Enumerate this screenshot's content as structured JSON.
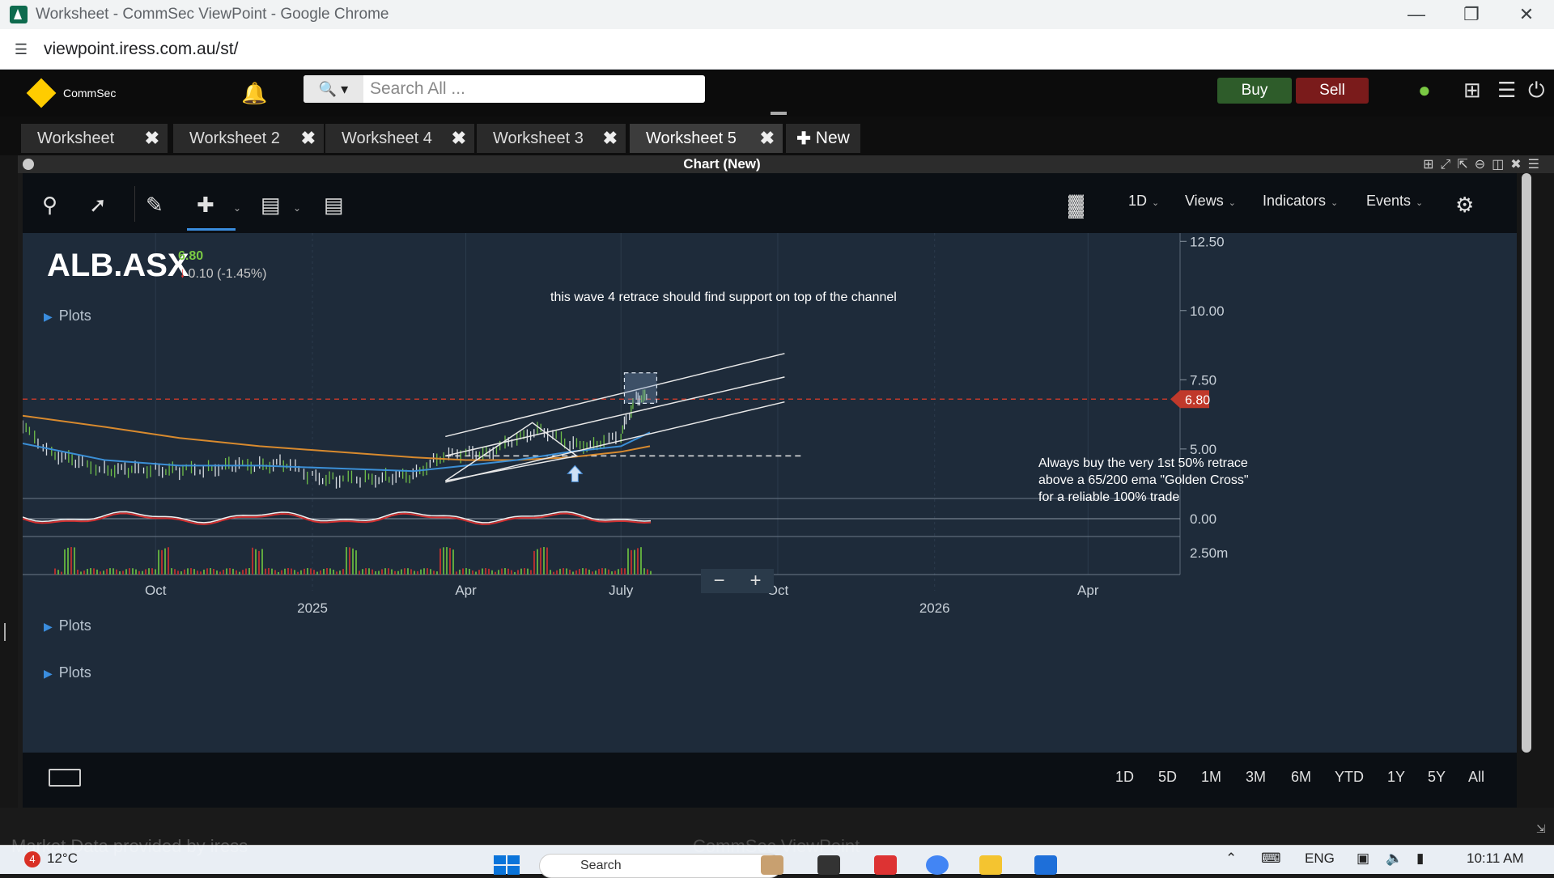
{
  "browser": {
    "window_title": "Worksheet - CommSec ViewPoint - Google Chrome",
    "url": "viewpoint.iress.com.au/st/"
  },
  "app": {
    "brand": "CommSec",
    "search_placeholder": "Search All ...",
    "buy_label": "Buy",
    "sell_label": "Sell"
  },
  "tabs": [
    {
      "label": "Worksheet",
      "active": false
    },
    {
      "label": "Worksheet 2",
      "active": false
    },
    {
      "label": "Worksheet 4",
      "active": false
    },
    {
      "label": "Worksheet 3",
      "active": false
    },
    {
      "label": "Worksheet 5",
      "active": true
    }
  ],
  "new_tab_label": "New",
  "panel": {
    "title": "Chart (New)"
  },
  "toolbar": {
    "interval": "1D",
    "views": "Views",
    "indicators": "Indicators",
    "events": "Events"
  },
  "quote": {
    "symbol": "ALB.ASX",
    "last": "6.80",
    "change": "0.10 (-1.45%)",
    "direction": "down"
  },
  "plots_label": "Plots",
  "annotations": {
    "wave_note": "this wave 4 retrace should find support on top of the channel",
    "golden_cross_note": [
      "Always buy the very 1st 50% retrace",
      "above a 65/200 ema \"Golden Cross\"",
      "for a reliable 100% trade"
    ]
  },
  "chart_data": {
    "type": "line",
    "symbol": "ALB.ASX",
    "y_ticks": [
      "12.50",
      "10.00",
      "7.50",
      "5.00"
    ],
    "ylim": [
      3.3,
      12.8
    ],
    "current_price_label": "6.80",
    "current_price": 6.8,
    "indicator_tick": "0.00",
    "volume_tick": "2.50m",
    "x_ticks_month": [
      "Oct",
      "Apr",
      "July",
      "Oct",
      "Apr"
    ],
    "x_ticks_year": [
      "2025",
      "2026"
    ],
    "x_tick_dates": [
      "2024-10-01",
      "2025-04-01",
      "2025-07-01",
      "2025-10-01",
      "2026-04-01"
    ],
    "year_tick_dates": [
      "2025-01-01",
      "2026-01-01"
    ],
    "x_start": "2024-07-15",
    "x_end": "2026-05-25",
    "support_level": 4.75,
    "price_series": {
      "name": "Close",
      "x": [
        "2024-07-15",
        "2024-08-01",
        "2024-08-15",
        "2024-09-01",
        "2024-09-15",
        "2024-10-01",
        "2024-10-15",
        "2024-11-01",
        "2024-11-15",
        "2024-12-01",
        "2024-12-15",
        "2025-01-01",
        "2025-01-15",
        "2025-02-01",
        "2025-02-15",
        "2025-03-01",
        "2025-03-15",
        "2025-04-01",
        "2025-04-15",
        "2025-05-01",
        "2025-05-15",
        "2025-06-01",
        "2025-06-15",
        "2025-07-01",
        "2025-07-10",
        "2025-07-18"
      ],
      "values": [
        5.8,
        4.9,
        4.5,
        4.3,
        4.2,
        4.3,
        4.2,
        4.3,
        4.4,
        4.4,
        4.5,
        4.0,
        3.9,
        3.9,
        4.0,
        4.0,
        4.7,
        4.8,
        4.9,
        5.3,
        5.8,
        5.1,
        5.2,
        5.4,
        6.9,
        6.8
      ]
    },
    "ema65": {
      "name": "EMA 65",
      "x": [
        "2024-07-15",
        "2024-09-01",
        "2024-10-15",
        "2024-12-01",
        "2025-01-15",
        "2025-03-01",
        "2025-04-01",
        "2025-05-01",
        "2025-06-01",
        "2025-07-01",
        "2025-07-18"
      ],
      "values": [
        5.2,
        4.6,
        4.4,
        4.4,
        4.3,
        4.2,
        4.4,
        4.6,
        4.9,
        5.1,
        5.6
      ]
    },
    "ema200": {
      "name": "EMA 200",
      "x": [
        "2024-07-15",
        "2024-09-01",
        "2024-10-15",
        "2024-12-01",
        "2025-01-15",
        "2025-03-01",
        "2025-04-01",
        "2025-05-01",
        "2025-06-01",
        "2025-07-01",
        "2025-07-18"
      ],
      "values": [
        6.2,
        5.8,
        5.4,
        5.1,
        4.9,
        4.7,
        4.6,
        4.6,
        4.7,
        4.9,
        5.1
      ]
    },
    "channel_lines": [
      {
        "x": [
          "2025-03-20",
          "2025-10-05"
        ],
        "values": [
          5.45,
          8.45
        ]
      },
      {
        "x": [
          "2025-03-20",
          "2025-10-05"
        ],
        "values": [
          4.75,
          7.6
        ]
      },
      {
        "x": [
          "2025-03-20",
          "2025-10-05"
        ],
        "values": [
          3.8,
          6.7
        ]
      }
    ],
    "grid": true,
    "legend": "none"
  },
  "range_buttons": [
    "1D",
    "5D",
    "1M",
    "3M",
    "6M",
    "YTD",
    "1Y",
    "5Y",
    "All"
  ],
  "taskbar": {
    "weather_alert": "4",
    "temperature": "12°C",
    "watermark": "Market Data provided by",
    "watermark_brand": "iress",
    "watermark_app": "CommSec ViewPoint",
    "search_label": "Search",
    "lang": "ENG",
    "time": "10:11 AM"
  }
}
